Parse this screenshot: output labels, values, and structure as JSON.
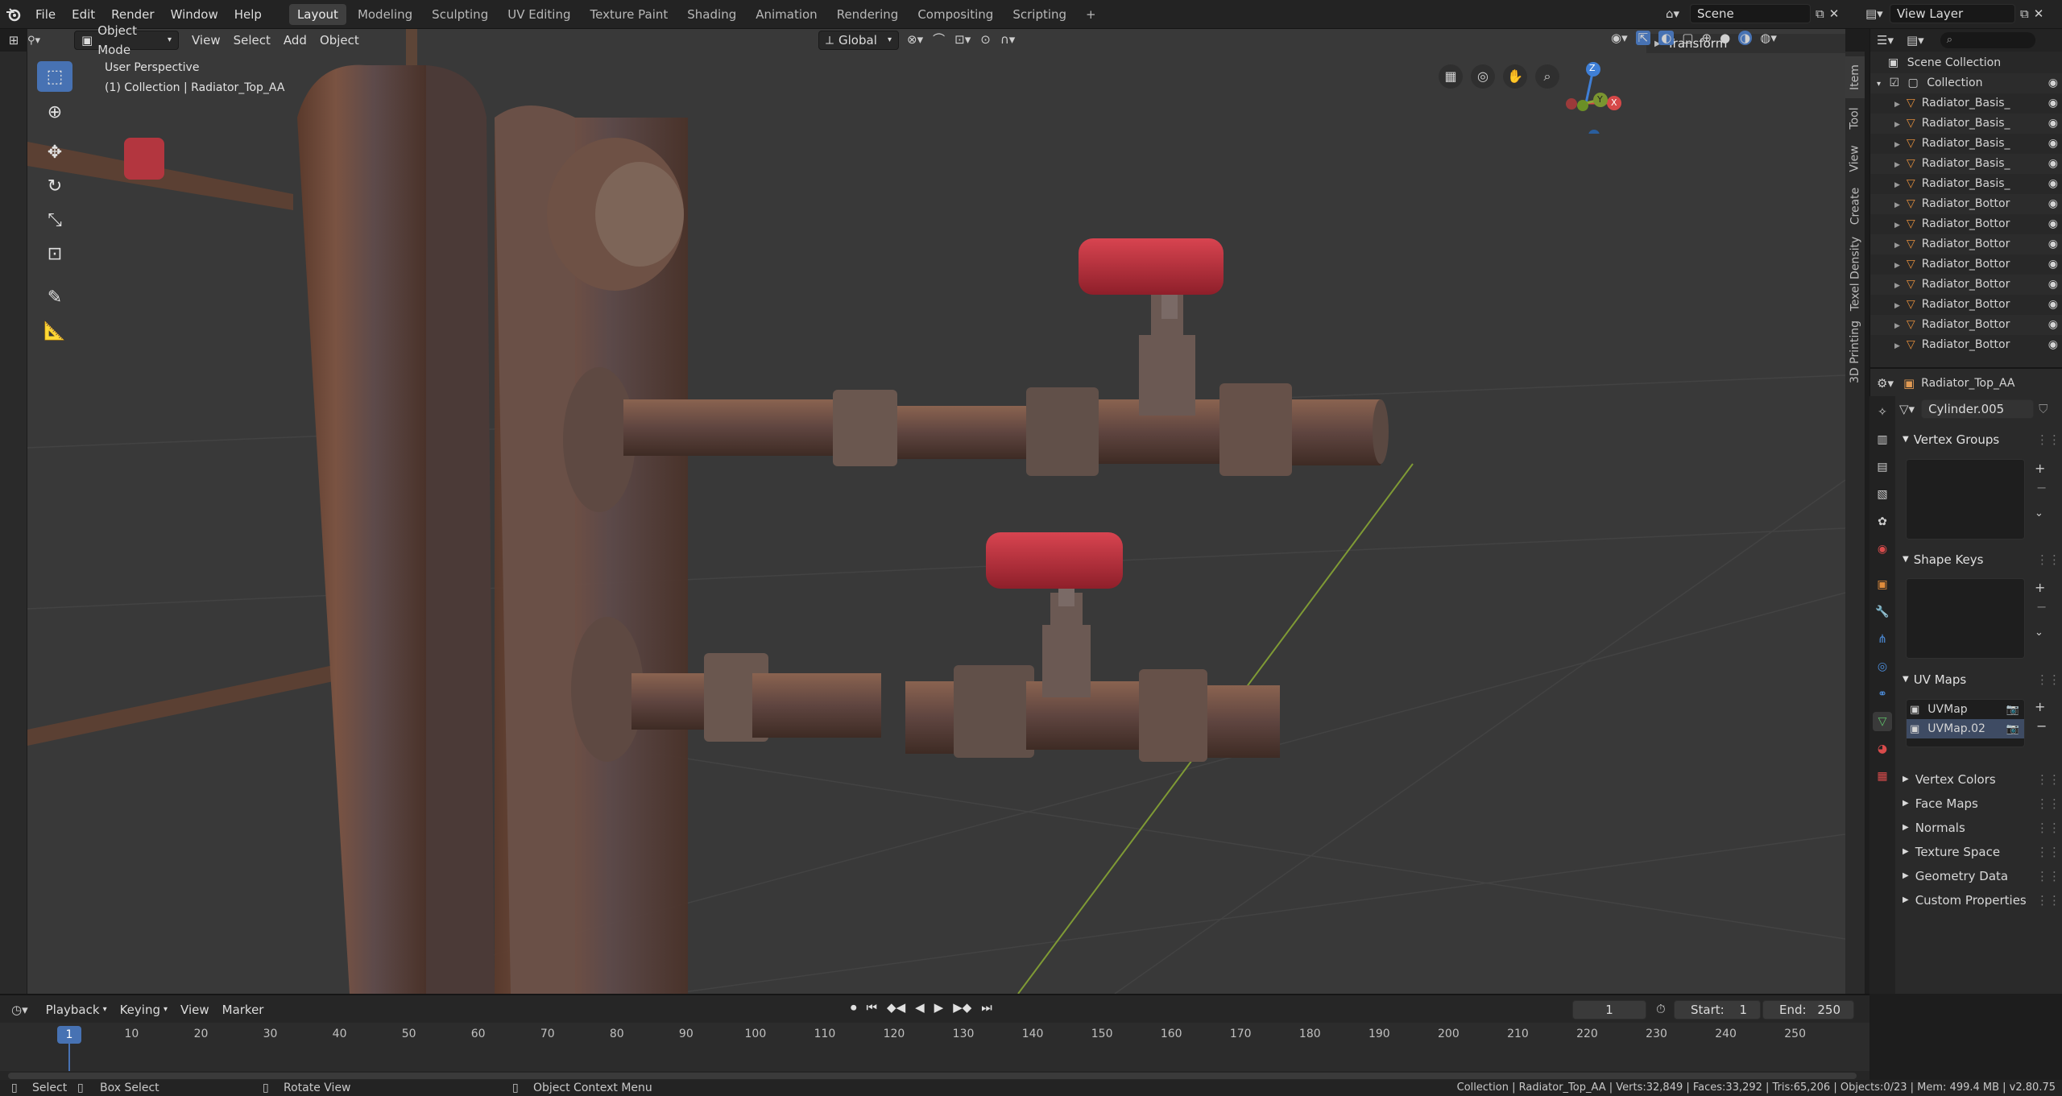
{
  "topbar": {
    "menus": [
      "File",
      "Edit",
      "Render",
      "Window",
      "Help"
    ],
    "workspace_tabs": [
      "Layout",
      "Modeling",
      "Sculpting",
      "UV Editing",
      "Texture Paint",
      "Shading",
      "Animation",
      "Rendering",
      "Compositing",
      "Scripting"
    ],
    "active_tab": "Layout",
    "add_tab": "+",
    "scene_value": "Scene",
    "view_layer_value": "View Layer"
  },
  "viewport_header": {
    "mode": "Object Mode",
    "menus": [
      "View",
      "Select",
      "Add",
      "Object"
    ],
    "transform_orientation": "Global"
  },
  "viewport": {
    "view_name": "User Perspective",
    "collection_info": "(1) Collection | Radiator_Top_AA",
    "gizmo_axes": [
      "Z",
      "Y",
      "X"
    ],
    "accent": "#4772b3"
  },
  "npanel": {
    "section": "Transform",
    "tabs": [
      "Item",
      "Tool",
      "View",
      "Create",
      "Texel Density",
      "3D Printing"
    ]
  },
  "outliner": {
    "root": "Scene Collection",
    "collection": "Collection",
    "items": [
      "Radiator_Basis_",
      "Radiator_Basis_",
      "Radiator_Basis_",
      "Radiator_Basis_",
      "Radiator_Basis_",
      "Radiator_Bottor",
      "Radiator_Bottor",
      "Radiator_Bottor",
      "Radiator_Bottor",
      "Radiator_Bottor",
      "Radiator_Bottor",
      "Radiator_Bottor",
      "Radiator_Bottor"
    ]
  },
  "properties": {
    "object_name": "Radiator_Top_AA",
    "mesh_name": "Cylinder.005",
    "panels": {
      "vertex_groups": "Vertex Groups",
      "shape_keys": "Shape Keys",
      "uv_maps": "UV Maps"
    },
    "uv_maps": [
      "UVMap",
      "UVMap.02"
    ],
    "collapsed_panels": [
      "Vertex Colors",
      "Face Maps",
      "Normals",
      "Texture Space",
      "Geometry Data",
      "Custom Properties"
    ]
  },
  "timeline": {
    "menus": [
      "Playback",
      "Keying",
      "View",
      "Marker"
    ],
    "current_frame": "1",
    "start_label": "Start:",
    "start_value": "1",
    "end_label": "End:",
    "end_value": "250",
    "ticks": [
      "1",
      "10",
      "20",
      "30",
      "40",
      "50",
      "60",
      "70",
      "80",
      "90",
      "100",
      "110",
      "120",
      "130",
      "140",
      "150",
      "160",
      "170",
      "180",
      "190",
      "200",
      "210",
      "220",
      "230",
      "240",
      "250"
    ]
  },
  "statusbar": {
    "select": "Select",
    "box_select": "Box Select",
    "rotate_view": "Rotate View",
    "context_menu": "Object Context Menu",
    "stats": "Collection | Radiator_Top_AA | Verts:32,849 | Faces:33,292 | Tris:65,206 | Objects:0/23 | Mem: 499.4 MB | v2.80.75"
  }
}
